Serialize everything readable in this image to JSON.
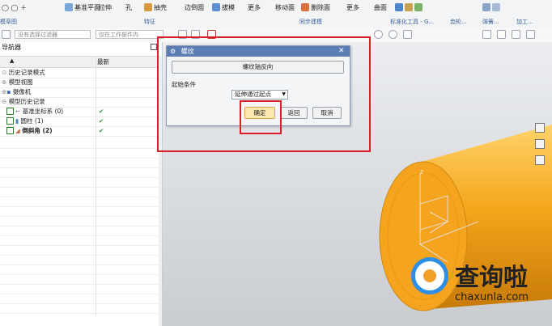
{
  "ribbon": {
    "buttons": [
      "基准平面",
      "拉伸",
      "孔",
      "抽壳",
      "边倒圆",
      "拔模",
      "更多",
      "移动面",
      "删除面",
      "更多",
      "曲面"
    ],
    "groups": [
      "模草图",
      "特征",
      "同步建模",
      "标准化工具 - G...",
      "齿轮...",
      "弹簧...",
      "加工..."
    ]
  },
  "toolbar2": {
    "filter_placeholder": "没有选择过滤器",
    "work_part_placeholder": "仅在工作部件内"
  },
  "navigator": {
    "title": "导航器",
    "col_latest": "最新",
    "items": [
      {
        "label": "历史记录模式",
        "latest": ""
      },
      {
        "label": "模型视图",
        "latest": ""
      },
      {
        "label": "摄像机",
        "latest": ""
      },
      {
        "label": "模型历史记录",
        "latest": ""
      },
      {
        "label": "基准坐标系 (0)",
        "latest": "✔"
      },
      {
        "label": "圆柱 (1)",
        "latest": "✔"
      },
      {
        "label": "倒斜角 (2)",
        "latest": "✔"
      }
    ]
  },
  "dialog": {
    "title": "螺纹",
    "reverse_axis_label": "螺纹轴反向",
    "start_condition_label": "起始条件",
    "start_condition_value": "延伸通过起点",
    "ok_label": "确定",
    "back_label": "返回",
    "cancel_label": "取消"
  },
  "watermark": {
    "name": "查询啦",
    "url": "chaxunla.com"
  },
  "colors": {
    "highlight": "#d8202a",
    "cylinder": "#f5a71c",
    "dialog_title": "#5b7db3"
  }
}
